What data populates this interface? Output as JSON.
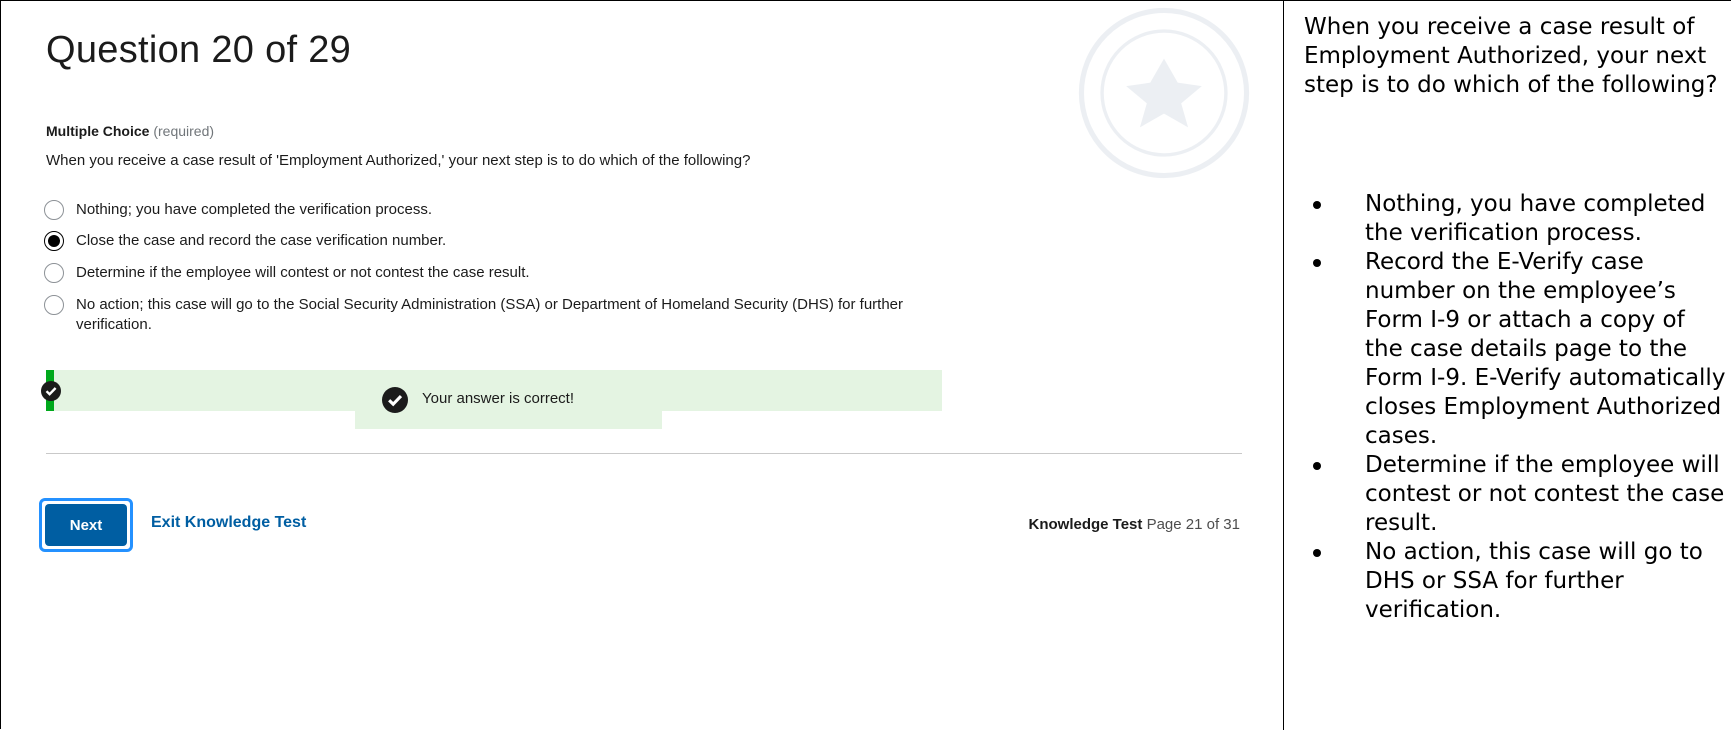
{
  "question": {
    "title": "Question 20 of 29",
    "type_label": "Multiple Choice",
    "required_label": "(required)",
    "prompt": "When you receive a case result of 'Employment Authorized,' your next step is to do which of the following?",
    "options": [
      {
        "label": "Nothing; you have completed the verification process.",
        "selected": false
      },
      {
        "label": "Close the case and record the case verification number.",
        "selected": true
      },
      {
        "label": "Determine if the employee will contest or not contest the case result.",
        "selected": false
      },
      {
        "label": "No action; this case will go to the Social Security Administration (SSA) or Department of Homeland Security (DHS) for further verification.",
        "selected": false
      }
    ]
  },
  "feedback": {
    "message": "Your answer is correct!",
    "status_color": "#00a91c",
    "background_color": "#e4f4e2",
    "icon": "check-circle-icon"
  },
  "footer": {
    "next_label": "Next",
    "exit_label": "Exit Knowledge Test",
    "page_label": "Knowledge Test",
    "page_numbers": "Page 21 of 31"
  },
  "side_panel": {
    "question": "When you receive a case result of Employment Authorized, your next step is to do which of the following?",
    "answers": [
      "Nothing, you have completed the verification process.",
      "Record the E-Verify case number on the employee’s Form I-9 or attach a copy of the case details page to the Form I-9. E-Verify automatically closes Employment Authorized cases.",
      "Determine if the employee will contest or not contest the case result.",
      "No action, this case will go to DHS or SSA for further verification."
    ]
  },
  "colors": {
    "primary": "#005ea2",
    "focus_ring": "#2491ff",
    "text": "#1b1b1b"
  }
}
